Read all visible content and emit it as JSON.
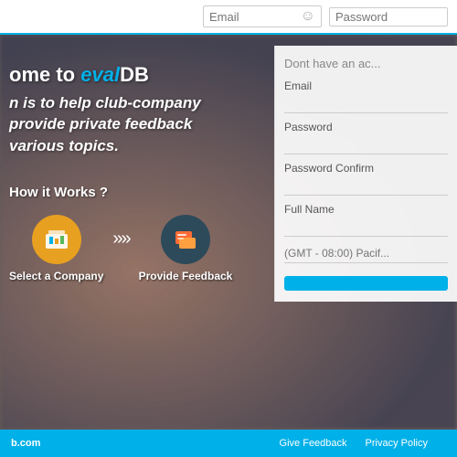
{
  "topnav": {
    "email_placeholder": "Email",
    "password_placeholder": "Password"
  },
  "hero": {
    "welcome_prefix": "ome to ",
    "brand_eval": "eval",
    "brand_db": "DB",
    "desc_line1": "n is to help club-company",
    "desc_line2": "provide private feedback",
    "desc_line3": "various topics.",
    "how_it_works": "How it Works ?",
    "step1_label": "Select a Company",
    "step2_label": "Provide Feedback",
    "arrow": "»»"
  },
  "right_panel": {
    "title": "Dont have an ac...",
    "email_label": "Email",
    "password_label": "Password",
    "password_confirm_label": "Password Confirm",
    "fullname_label": "Full Name",
    "timezone_placeholder": "(GMT - 08:00) Pacif...",
    "signup_button": ""
  },
  "bottom_bar": {
    "logo": "b.com",
    "link1": "Give Feedback",
    "link2": "Privacy Policy"
  }
}
